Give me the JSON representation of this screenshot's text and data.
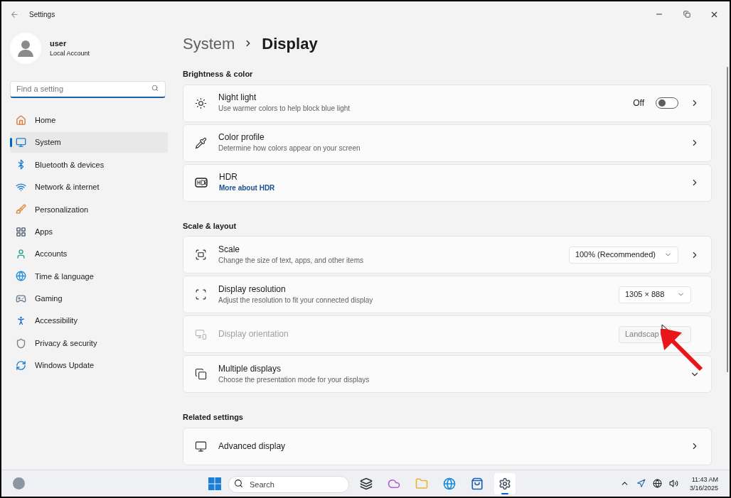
{
  "window": {
    "title": "Settings"
  },
  "account": {
    "name": "user",
    "type": "Local Account"
  },
  "search": {
    "placeholder": "Find a setting"
  },
  "nav": [
    {
      "label": "Home",
      "selected": false
    },
    {
      "label": "System",
      "selected": true
    },
    {
      "label": "Bluetooth & devices",
      "selected": false
    },
    {
      "label": "Network & internet",
      "selected": false
    },
    {
      "label": "Personalization",
      "selected": false
    },
    {
      "label": "Apps",
      "selected": false
    },
    {
      "label": "Accounts",
      "selected": false
    },
    {
      "label": "Time & language",
      "selected": false
    },
    {
      "label": "Gaming",
      "selected": false
    },
    {
      "label": "Accessibility",
      "selected": false
    },
    {
      "label": "Privacy & security",
      "selected": false
    },
    {
      "label": "Windows Update",
      "selected": false
    }
  ],
  "breadcrumb": [
    "System",
    "Display"
  ],
  "sections": [
    {
      "heading": "Brightness & color",
      "rows": [
        {
          "kind": "toggle",
          "title": "Night light",
          "description": "Use warmer colors to help block blue light",
          "toggle_label": "Off",
          "on": false,
          "disabled": false
        },
        {
          "kind": "nav",
          "title": "Color profile",
          "description": "Determine how colors appear on your screen",
          "disabled": false
        },
        {
          "kind": "nav",
          "title": "HDR",
          "link": "More about HDR",
          "disabled": false
        }
      ]
    },
    {
      "heading": "Scale & layout",
      "rows": [
        {
          "kind": "dropdown-nav",
          "title": "Scale",
          "description": "Change the size of text, apps, and other items",
          "value": "100% (Recommended)",
          "disabled": false
        },
        {
          "kind": "dropdown",
          "title": "Display resolution",
          "description": "Adjust the resolution to fit your connected display",
          "value": "1305 × 888",
          "disabled": false
        },
        {
          "kind": "dropdown",
          "title": "Display orientation",
          "value": "Landscap",
          "disabled": true
        },
        {
          "kind": "expand",
          "title": "Multiple displays",
          "description": "Choose the presentation mode for your displays",
          "expanded": false,
          "disabled": false
        }
      ]
    },
    {
      "heading": "Related settings",
      "rows": [
        {
          "kind": "nav",
          "title": "Advanced display",
          "disabled": false
        }
      ]
    }
  ],
  "taskbar": {
    "search_placeholder": "Search",
    "apps": [
      {
        "selected": false
      },
      {
        "selected": false
      },
      {
        "selected": false
      },
      {
        "selected": false
      },
      {
        "selected": false
      },
      {
        "selected": true
      }
    ],
    "time": "11:43 AM",
    "date": "3/16/2025"
  }
}
